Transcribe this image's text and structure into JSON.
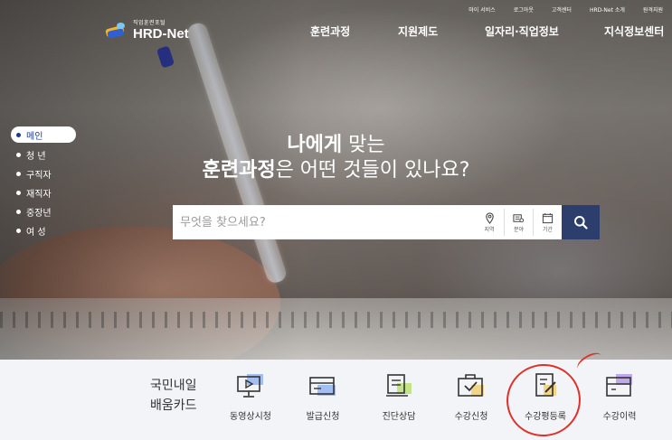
{
  "logo": {
    "small_text": "직업훈련포털",
    "brand": "HRD-Net"
  },
  "top_nav": [
    "마이 서비스",
    "로그아웃",
    "고객센터",
    "HRD-Net 소개",
    "원격지원"
  ],
  "main_nav": [
    "훈련과정",
    "지원제도",
    "일자리·직업정보",
    "지식정보센터"
  ],
  "side_menu": [
    {
      "label": "메인",
      "active": true
    },
    {
      "label": "청 년",
      "active": false
    },
    {
      "label": "구직자",
      "active": false
    },
    {
      "label": "재직자",
      "active": false
    },
    {
      "label": "중장년",
      "active": false
    },
    {
      "label": "여 성",
      "active": false
    }
  ],
  "headline": {
    "line1_bold": "나에게",
    "line1_rest": " 맞는",
    "line2_bold": "훈련과정",
    "line2_rest": "은 어떤 것들이 있나요?"
  },
  "search": {
    "placeholder": "무엇을 찾으세요?",
    "filters": [
      {
        "label": "지역",
        "icon": "location-pin-icon"
      },
      {
        "label": "분야",
        "icon": "category-icon"
      },
      {
        "label": "기간",
        "icon": "calendar-icon"
      }
    ],
    "button_icon": "search-icon"
  },
  "card": {
    "title_line1": "국민내일",
    "title_line2": "배움카드",
    "items": [
      {
        "label": "동영상시청",
        "icon": "video-monitor-icon"
      },
      {
        "label": "발급신청",
        "icon": "card-issue-icon"
      },
      {
        "label": "진단상담",
        "icon": "diagnosis-icon"
      },
      {
        "label": "수강신청",
        "icon": "course-apply-icon"
      },
      {
        "label": "수강평등록",
        "icon": "review-write-icon"
      },
      {
        "label": "수강이력",
        "icon": "course-history-icon"
      }
    ]
  },
  "colors": {
    "brand_navy": "#2c3e6b",
    "active_blue": "#1c3b8c",
    "highlight_circle": "#e0302a",
    "icon_accent_blue": "#6f8fe0",
    "icon_accent_yellow": "#f2d27a",
    "icon_accent_purple": "#b59be8"
  }
}
